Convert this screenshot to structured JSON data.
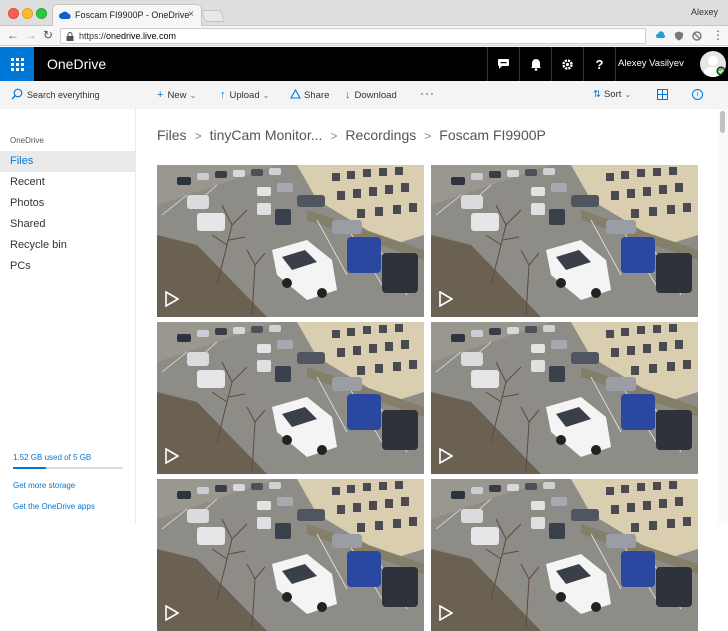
{
  "browser": {
    "tab_title": "Foscam FI9900P - OneDrive",
    "tab_close": "×",
    "profile_name": "Alexey",
    "url_scheme": "https://",
    "url_host": "onedrive.live.com"
  },
  "header": {
    "brand": "OneDrive",
    "user_name": "Alexey Vasilyev",
    "icons": [
      "chat-icon",
      "bell-icon",
      "gear-icon",
      "help-icon"
    ],
    "help_glyph": "?"
  },
  "commandbar": {
    "search_placeholder": "Search everything",
    "new_label": "New",
    "upload_label": "Upload",
    "share_label": "Share",
    "download_label": "Download",
    "more_label": "···",
    "sort_label": "Sort"
  },
  "sidebar": {
    "section_label": "OneDrive",
    "items": [
      {
        "label": "Files",
        "active": true
      },
      {
        "label": "Recent",
        "active": false
      },
      {
        "label": "Photos",
        "active": false
      },
      {
        "label": "Shared",
        "active": false
      },
      {
        "label": "Recycle bin",
        "active": false
      },
      {
        "label": "PCs",
        "active": false
      }
    ],
    "quota_text": "1.52 GB used of 5 GB",
    "quota_used_fraction": 0.304,
    "get_storage": "Get more storage",
    "get_apps": "Get the OneDrive apps"
  },
  "main": {
    "breadcrumb": [
      "Files",
      "tinyCam Monitor...",
      "Recordings",
      "Foscam FI9900P"
    ],
    "breadcrumb_sep": ">",
    "thumbnail_count": 6
  },
  "colors": {
    "accent": "#0078d7",
    "header_bg": "#000000",
    "cmdbar_bg": "#f4f4f4"
  }
}
